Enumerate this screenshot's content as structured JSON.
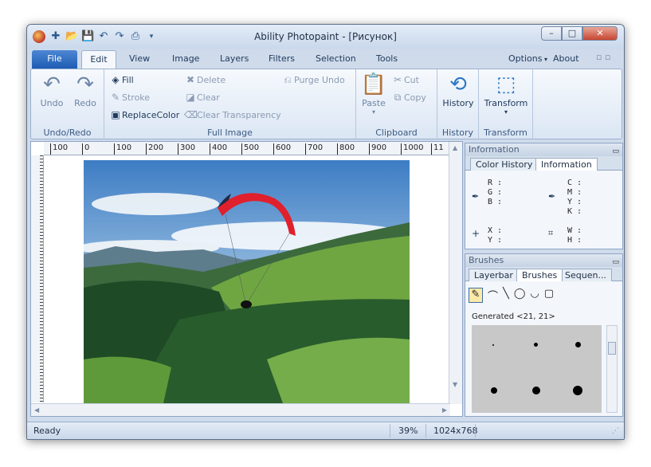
{
  "window": {
    "title": "Ability Photopaint - [Рисунок]"
  },
  "tabs": [
    "File",
    "Edit",
    "View",
    "Image",
    "Layers",
    "Filters",
    "Selection",
    "Tools"
  ],
  "tabs_right": {
    "options": "Options",
    "about": "About"
  },
  "ribbon": {
    "undo": "Undo",
    "redo": "Redo",
    "group_undoredo": "Undo/Redo",
    "fill": "Fill",
    "stroke": "Stroke",
    "replacecolor": "ReplaceColor",
    "delete": "Delete",
    "clear": "Clear",
    "clear_transparency": "Clear Transparency",
    "purge_undo": "Purge Undo",
    "group_fullimage": "Full Image",
    "paste": "Paste",
    "cut": "Cut",
    "copy": "Copy",
    "group_clipboard": "Clipboard",
    "history": "History",
    "group_history": "History",
    "transform": "Transform",
    "group_transform": "Transform"
  },
  "ruler": [
    "100",
    "0",
    "100",
    "200",
    "300",
    "400",
    "500",
    "600",
    "700",
    "800",
    "900",
    "1000",
    "11"
  ],
  "info_panel": {
    "title": "Information",
    "tabs": [
      "Color History",
      "Information"
    ],
    "rgb": "R :\nG :\nB :",
    "cmyk": "C :\nM :\nY :\nK :",
    "xy": "X :\nY :",
    "wh": "W :\nH :"
  },
  "brushes_panel": {
    "title": "Brushes",
    "tabs": [
      "Layerbar",
      "Brushes",
      "Sequen..."
    ],
    "generated": "Generated <21, 21>"
  },
  "status": {
    "left": "Ready",
    "zoom": "39%",
    "size": "1024x768"
  },
  "colors": {
    "accent": "#1e5cb3",
    "ribbon_bg": "#dbe6f4"
  }
}
